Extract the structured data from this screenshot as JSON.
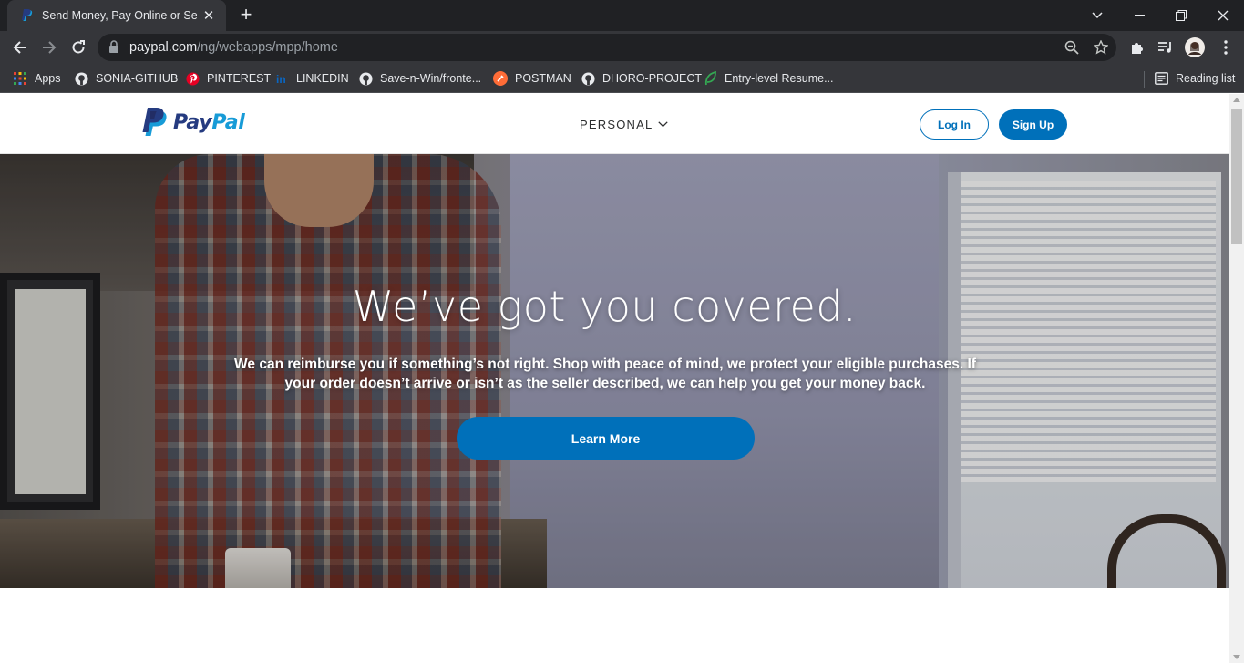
{
  "browser": {
    "tab": {
      "title": "Send Money, Pay Online or Set U",
      "close_glyph": "✕"
    },
    "new_tab_glyph": "+",
    "url": {
      "host": "paypal.com",
      "path": "/ng/webapps/mpp/home"
    },
    "bookmarks": [
      {
        "label": "Apps",
        "icon": "apps-grid-icon"
      },
      {
        "label": "SONIA-GITHUB",
        "icon": "github-icon"
      },
      {
        "label": "PINTEREST",
        "icon": "pinterest-icon"
      },
      {
        "label": "LINKEDIN",
        "icon": "linkedin-icon"
      },
      {
        "label": "Save-n-Win/fronte...",
        "icon": "github-icon"
      },
      {
        "label": "POSTMAN",
        "icon": "postman-icon"
      },
      {
        "label": "DHORO-PROJECT",
        "icon": "github-icon"
      },
      {
        "label": "Entry-level Resume...",
        "icon": "leaf-icon"
      }
    ],
    "reading_list": "Reading list"
  },
  "site": {
    "logo_pay": "Pay",
    "logo_pal": "Pal",
    "nav_personal": "PERSONAL",
    "login_label": "Log In",
    "signup_label": "Sign Up"
  },
  "hero": {
    "title": "We’ve got you covered.",
    "text": "We can reimburse you if something’s not right. Shop with peace of mind, we protect your eligible purchases. If your order doesn’t arrive or isn’t as the seller described, we can help you get your money back.",
    "button_label": "Learn More"
  },
  "colors": {
    "brand_blue": "#0070ba",
    "logo_dark": "#253b80",
    "logo_light": "#179bd7",
    "chrome_dark": "#202124",
    "chrome_mid": "#35363a"
  }
}
